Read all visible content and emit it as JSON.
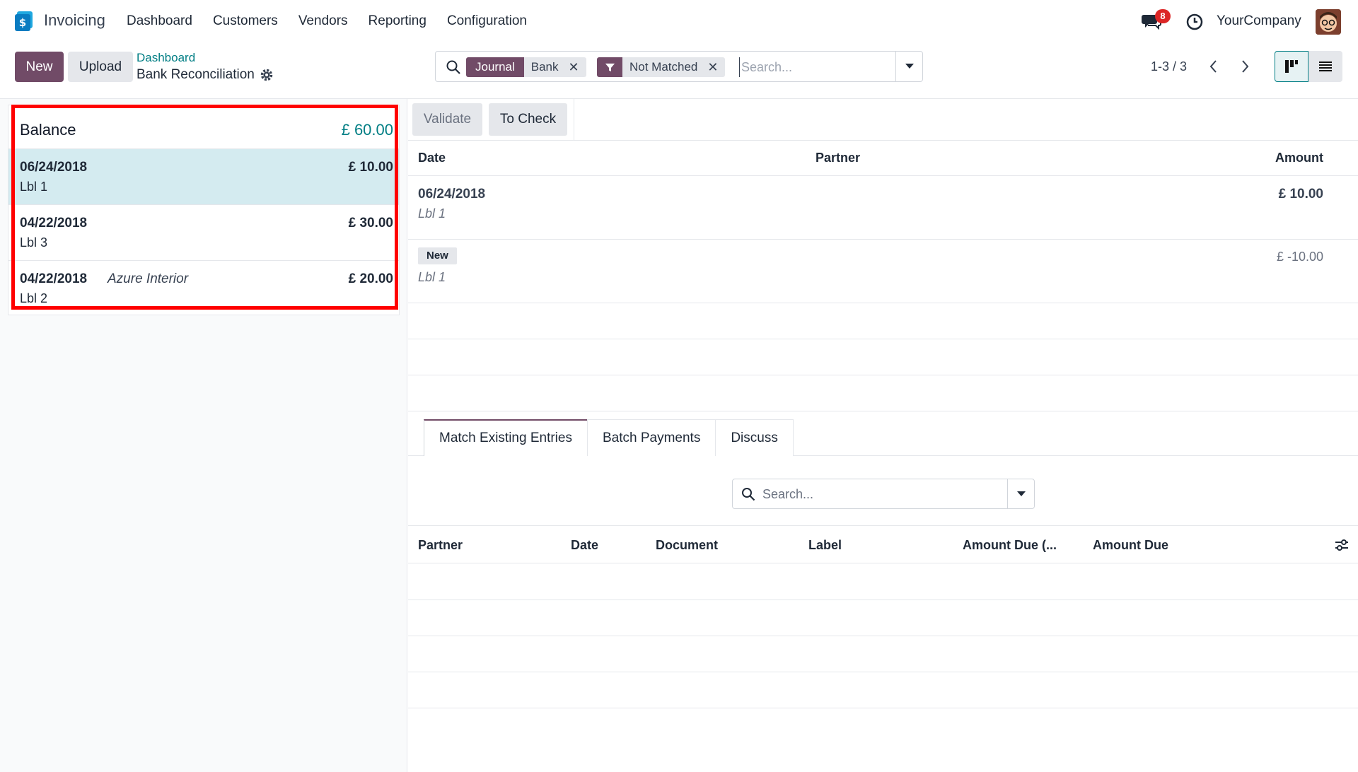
{
  "nav": {
    "app_name": "Invoicing",
    "menu": [
      "Dashboard",
      "Customers",
      "Vendors",
      "Reporting",
      "Configuration"
    ],
    "chat_badge": "8",
    "company": "YourCompany"
  },
  "control": {
    "new_label": "New",
    "upload_label": "Upload",
    "breadcrumb_link": "Dashboard",
    "breadcrumb_title": "Bank Reconciliation",
    "search": {
      "facet_journal_label": "Journal",
      "facet_journal_value": "Bank",
      "facet_filter_value": "Not Matched",
      "placeholder": "Search..."
    },
    "pager": "1-3 / 3"
  },
  "left": {
    "balance_label": "Balance",
    "balance_amount": "£ 60.00",
    "statements": [
      {
        "date": "06/24/2018",
        "partner": "",
        "amount": "£ 10.00",
        "label": "Lbl 1"
      },
      {
        "date": "04/22/2018",
        "partner": "",
        "amount": "£ 30.00",
        "label": "Lbl 3"
      },
      {
        "date": "04/22/2018",
        "partner": "Azure Interior",
        "amount": "£ 20.00",
        "label": "Lbl 2"
      }
    ]
  },
  "right": {
    "validate_label": "Validate",
    "tocheck_label": "To Check",
    "headers": {
      "date": "Date",
      "partner": "Partner",
      "amount": "Amount"
    },
    "lines": [
      {
        "date": "06/24/2018",
        "label": "Lbl 1",
        "amount": "£ 10.00"
      },
      {
        "badge": "New",
        "label": "Lbl 1",
        "amount": "£ -10.00"
      }
    ],
    "tabs": [
      "Match Existing Entries",
      "Batch Payments",
      "Discuss"
    ],
    "sub_search_placeholder": "Search...",
    "match_headers": [
      "Partner",
      "Date",
      "Document",
      "Label",
      "Amount Due (...",
      "Amount Due"
    ]
  },
  "colors": {
    "brand": "#714b67",
    "teal": "#017e84",
    "selected_row": "#d4ebf0",
    "highlight": "#ff0000"
  }
}
